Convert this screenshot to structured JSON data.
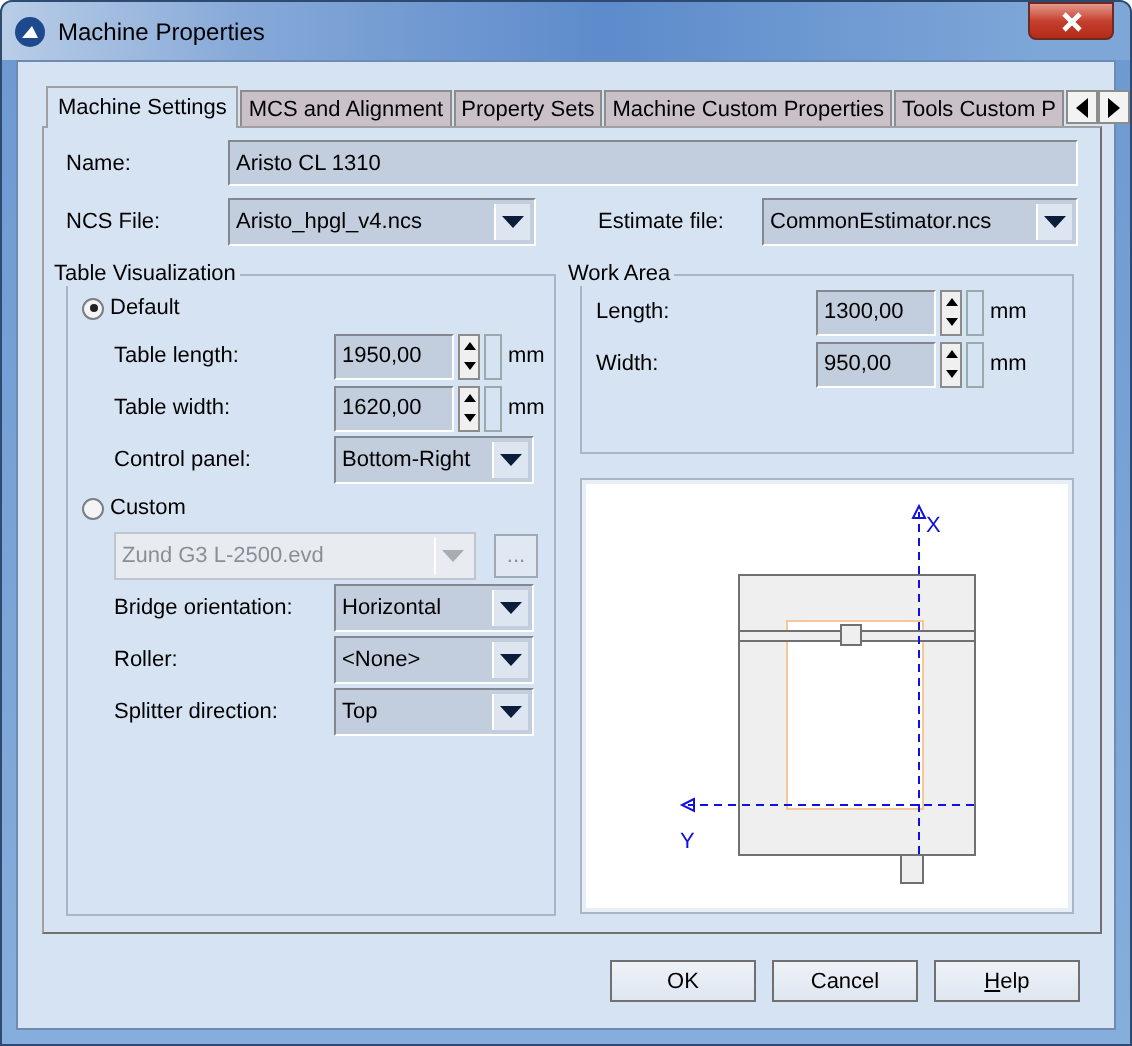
{
  "window": {
    "title": "Machine Properties"
  },
  "tabs": [
    {
      "label": "Machine Settings",
      "selected": true
    },
    {
      "label": "MCS and Alignment",
      "selected": false
    },
    {
      "label": "Property Sets",
      "selected": false
    },
    {
      "label": "Machine Custom Properties",
      "selected": false
    },
    {
      "label": "Tools Custom P",
      "selected": false
    }
  ],
  "name": {
    "label": "Name:",
    "value": "Aristo CL 1310"
  },
  "ncs_file": {
    "label": "NCS File:",
    "value": "Aristo_hpgl_v4.ncs"
  },
  "estimate_file": {
    "label": "Estimate file:",
    "value": "CommonEstimator.ncs"
  },
  "table_visualization": {
    "title": "Table Visualization",
    "options": [
      {
        "label": "Default",
        "selected": true
      },
      {
        "label": "Custom",
        "selected": false
      }
    ],
    "default_fields": [
      {
        "kind": "spin",
        "label": "Table length:",
        "value": "1950,00",
        "unit": "mm"
      },
      {
        "kind": "spin",
        "label": "Table width:",
        "value": "1620,00",
        "unit": "mm"
      },
      {
        "kind": "combo",
        "label": "Control panel:",
        "value": "Bottom-Right"
      }
    ],
    "custom_file": {
      "value": "Zund G3 L-2500.evd",
      "disabled": true,
      "browse": "..."
    },
    "custom_fields": [
      {
        "kind": "combo",
        "label": "Bridge orientation:",
        "value": "Horizontal"
      },
      {
        "kind": "combo",
        "label": "Roller:",
        "value": "<None>"
      },
      {
        "kind": "combo",
        "label": "Splitter direction:",
        "value": "Top"
      }
    ]
  },
  "work_area": {
    "title": "Work Area",
    "fields": [
      {
        "kind": "spin",
        "label": "Length:",
        "value": "1300,00",
        "unit": "mm"
      },
      {
        "kind": "spin",
        "label": "Width:",
        "value": "950,00",
        "unit": "mm"
      }
    ]
  },
  "preview": {
    "x_axis": "X",
    "y_axis": "Y"
  },
  "buttons": [
    {
      "label": "OK"
    },
    {
      "label": "Cancel"
    },
    {
      "access_key": "H",
      "label_rest": "elp"
    }
  ]
}
